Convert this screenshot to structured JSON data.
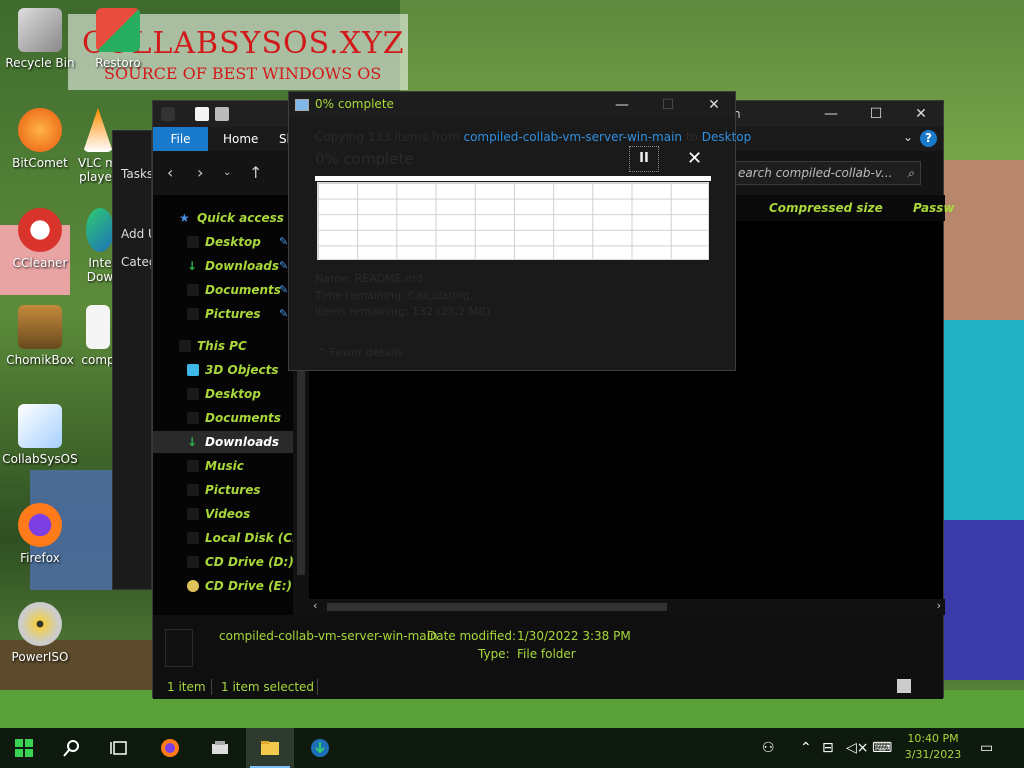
{
  "watermark": {
    "title": "COLLABSYSOS.XYZ",
    "subtitle": "SOURCE OF BEST WINDOWS OS"
  },
  "desktop_icons": [
    {
      "label": "Recycle Bin",
      "icon": "recycle-bin-icon"
    },
    {
      "label": "Restoro",
      "icon": "restoro-icon"
    },
    {
      "label": "BitComet",
      "icon": "bitcomet-icon"
    },
    {
      "label": "VLC media\nplayer",
      "icon": "vlc-icon"
    },
    {
      "label": "CCleaner",
      "icon": "ccleaner-icon"
    },
    {
      "label": "Inte\nDow",
      "icon": "internet-download-icon"
    },
    {
      "label": "ChomikBox",
      "icon": "chomikbox-icon"
    },
    {
      "label": "comp",
      "icon": "folder-icon"
    },
    {
      "label": "CollabSysOS",
      "icon": "collabsysos-icon"
    },
    {
      "label": "Firefox",
      "icon": "firefox-icon"
    },
    {
      "label": "PowerISO",
      "icon": "poweriso-icon"
    }
  ],
  "back_window": {
    "tasks_label": "Tasks",
    "add_label": "Add U",
    "category_label": "Categ"
  },
  "explorer": {
    "title_fragment": "n",
    "ribbon": {
      "file": "File",
      "home": "Home",
      "share": "Sh"
    },
    "search_placeholder": "earch compiled-collab-v...",
    "columns": [
      "Compressed size",
      "Passw"
    ],
    "nav": {
      "quick_access": "Quick access",
      "qa_items": [
        "Desktop",
        "Downloads",
        "Documents",
        "Pictures"
      ],
      "this_pc": "This PC",
      "pc_items": [
        "3D Objects",
        "Desktop",
        "Documents",
        "Downloads",
        "Music",
        "Pictures",
        "Videos",
        "Local Disk (C:)",
        "CD Drive (D:) v",
        "CD Drive (E:)"
      ],
      "selected": "Downloads"
    },
    "details": {
      "name": "compiled-collab-vm-server-win-main",
      "date_modified_label": "Date modified:",
      "date_modified_value": "1/30/2022 3:38 PM",
      "type_label": "Type:",
      "type_value": "File folder"
    },
    "status": {
      "count": "1 item",
      "selected": "1 item selected"
    }
  },
  "copy_dialog": {
    "title": "0% complete",
    "copying_prefix": "Copying 133 items from",
    "source": "compiled-collab-vm-server-win-main",
    "to_word": "to",
    "destination": "Desktop",
    "percent_text": "0% complete",
    "progress_percent": 0,
    "pause_label": "II",
    "close_label": "✕",
    "name_label": "Name:",
    "name_value": "README.md",
    "time_label": "Time remaining:",
    "time_value": "Calculating...",
    "items_label": "Items remaining:",
    "items_value": "132 (28.2 MB)",
    "fewer_details": "Fewer details"
  },
  "taskbar": {
    "items": [
      "start-icon",
      "search-icon",
      "task-view-icon",
      "firefox-icon",
      "app-icon",
      "file-explorer-icon",
      "internet-download-icon"
    ],
    "time": "10:40 PM",
    "date": "3/31/2023",
    "colors": {
      "accent": "#a8d83b",
      "start": "#39d353"
    }
  }
}
